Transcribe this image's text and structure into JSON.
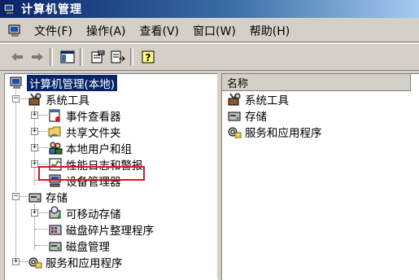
{
  "window": {
    "title": "计算机管理"
  },
  "menu": {
    "items": [
      {
        "label": "文件(F)"
      },
      {
        "label": "操作(A)"
      },
      {
        "label": "查看(V)"
      },
      {
        "label": "窗口(W)"
      },
      {
        "label": "帮助(H)"
      }
    ]
  },
  "toolbar": {
    "icons": [
      "back-arrow-icon",
      "forward-arrow-icon",
      "show-hide-tree-icon",
      "properties-icon",
      "export-list-icon",
      "help-icon"
    ]
  },
  "tree": {
    "root": "计算机管理(本地)",
    "system_tools": "系统工具",
    "event_viewer": "事件查看器",
    "shared_folders": "共享文件夹",
    "local_users": "本地用户和组",
    "perf_logs": "性能日志和警报",
    "device_manager": "设备管理器",
    "storage": "存储",
    "removable_storage": "可移动存储",
    "defrag": "磁盘碎片整理程序",
    "disk_management": "磁盘管理",
    "services_apps": "服务和应用程序",
    "expander_plus": "+",
    "expander_minus": "−"
  },
  "list": {
    "header": "名称",
    "items": [
      {
        "label": "系统工具"
      },
      {
        "label": "存储"
      },
      {
        "label": "服务和应用程序"
      }
    ]
  },
  "colors": {
    "title_active": "#0a246a",
    "selection": "#0a246a",
    "annotation_red": "#e0141e",
    "chrome": "#d4d0c8"
  }
}
